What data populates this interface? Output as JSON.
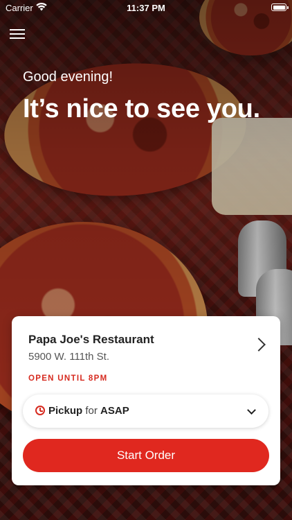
{
  "status_bar": {
    "carrier": "Carrier",
    "time": "11:37 PM"
  },
  "greeting": {
    "small": "Good evening!",
    "large": "It’s nice to see you."
  },
  "restaurant": {
    "name": "Papa Joe's Restaurant",
    "address": "5900 W. 111th St.",
    "open_status": "OPEN UNTIL 8PM"
  },
  "order_options": {
    "mode": "Pickup",
    "connector": "for",
    "time": "ASAP"
  },
  "actions": {
    "start_order": "Start Order"
  },
  "icons": {
    "menu": "hamburger-menu-icon",
    "wifi": "wifi-icon",
    "battery": "battery-icon",
    "chevron": "chevron-right-icon",
    "clock": "clock-icon",
    "dropdown": "chevron-down-icon"
  },
  "colors": {
    "accent": "#e0281f",
    "open_text": "#d62a1f"
  }
}
